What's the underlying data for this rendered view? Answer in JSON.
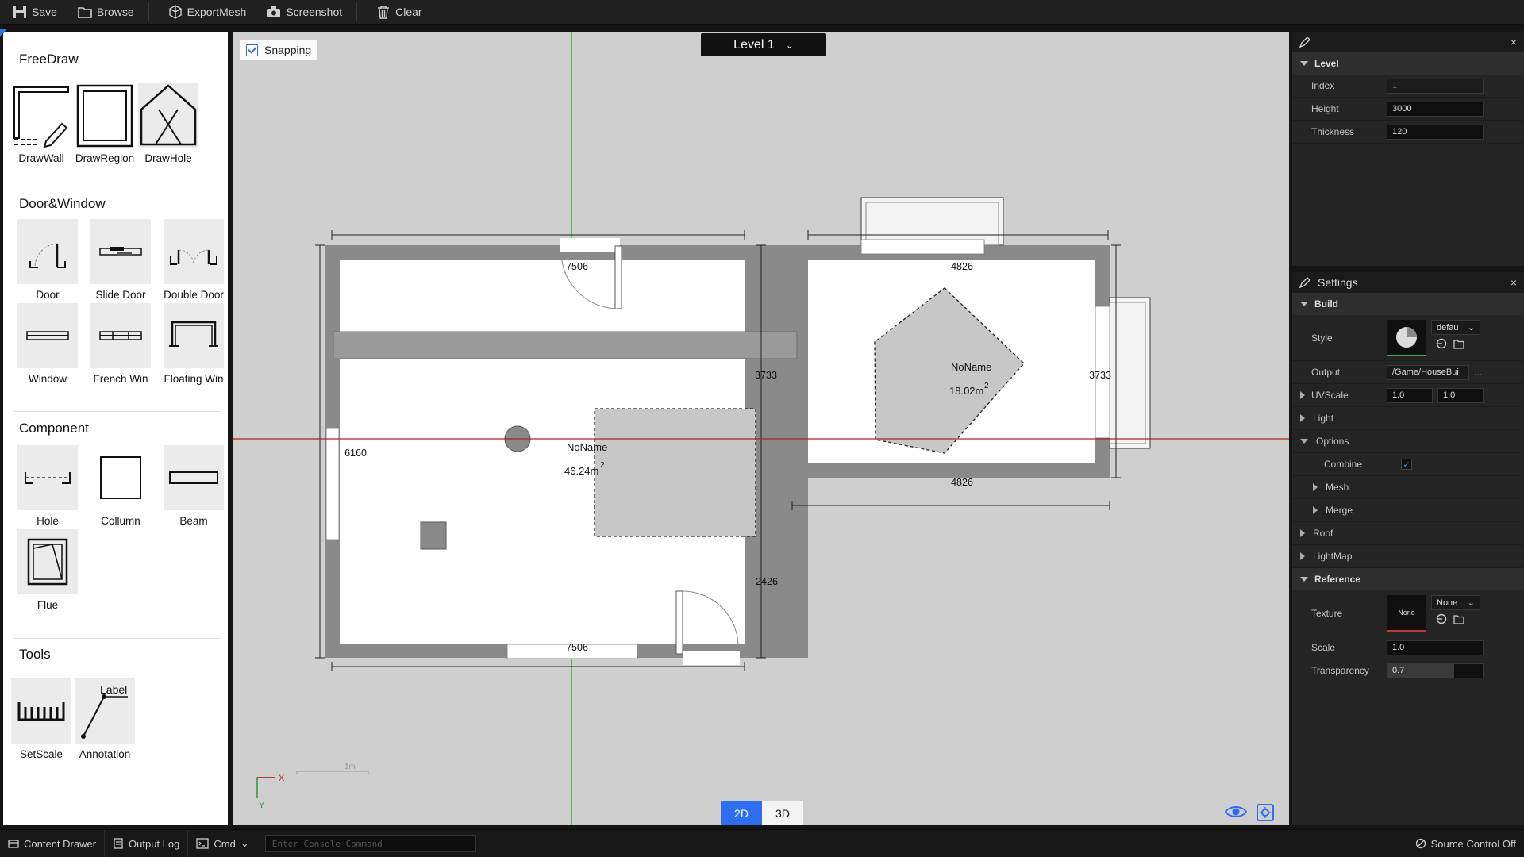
{
  "toolbar": {
    "save": "Save",
    "browse": "Browse",
    "export_mesh": "ExportMesh",
    "screenshot": "Screenshot",
    "clear": "Clear"
  },
  "left_panel": {
    "freedraw": {
      "title": "FreeDraw",
      "items": [
        "DrawWall",
        "DrawRegion",
        "DrawHole"
      ]
    },
    "door_window": {
      "title": "Door&Window",
      "items": [
        "Door",
        "Slide Door",
        "Double Door",
        "Window",
        "French Win",
        "Floating Win"
      ]
    },
    "component": {
      "title": "Component",
      "items": [
        "Hole",
        "Collumn",
        "Beam",
        "Flue"
      ]
    },
    "tools": {
      "title": "Tools",
      "items": [
        "SetScale",
        "Annotation"
      ],
      "annotation_icon_text": "Label"
    }
  },
  "viewport": {
    "snapping_label": "Snapping",
    "snapping_checked": true,
    "level_selector": "Level 1",
    "mode_2d": "2D",
    "mode_3d": "3D",
    "active_mode": "2D",
    "axis_x_label": "X",
    "axis_y_label": "Y",
    "scale_label": "1m",
    "dimensions": {
      "left_top": "7506",
      "left_bottom": "7506",
      "left_side": "6160",
      "middle_upper": "3733",
      "middle_lower": "2426",
      "right_top": "4826",
      "right_bottom": "4826",
      "right_side": "3733"
    },
    "regions": [
      {
        "name": "NoName",
        "area": "46.24m",
        "sup": "2"
      },
      {
        "name": "NoName",
        "area": "18.02m",
        "sup": "2"
      }
    ],
    "colors": {
      "x_axis": "#b02020",
      "y_axis": "#2e9a2e",
      "wall": "#8a8a8a",
      "region": "#c7c7c7"
    }
  },
  "level_panel": {
    "section": "Level",
    "rows": [
      {
        "name": "Index",
        "value": "1"
      },
      {
        "name": "Height",
        "value": "3000"
      },
      {
        "name": "Thickness",
        "value": "120"
      }
    ]
  },
  "settings_panel": {
    "tab": "Settings",
    "build": "Build",
    "style_label": "Style",
    "style_value": "defau",
    "output_label": "Output",
    "output_value": "/Game/HouseBui",
    "output_more": "...",
    "uvscale_label": "UVScale",
    "uvscale_u": "1.0",
    "uvscale_v": "1.0",
    "light": "Light",
    "options": "Options",
    "combine": "Combine",
    "combine_checked": true,
    "mesh": "Mesh",
    "merge": "Merge",
    "roof": "Roof",
    "lightmap": "LightMap",
    "reference": "Reference",
    "texture_label": "Texture",
    "texture_thumb": "None",
    "texture_value": "None",
    "scale_label": "Scale",
    "scale_value": "1.0",
    "transparency_label": "Transparency",
    "transparency_value": "0.7",
    "transparency_fraction": 0.7
  },
  "statusbar": {
    "content_drawer": "Content Drawer",
    "output_log": "Output Log",
    "cmd": "Cmd",
    "console_placeholder": "Enter Console Command",
    "source_control": "Source Control Off"
  }
}
